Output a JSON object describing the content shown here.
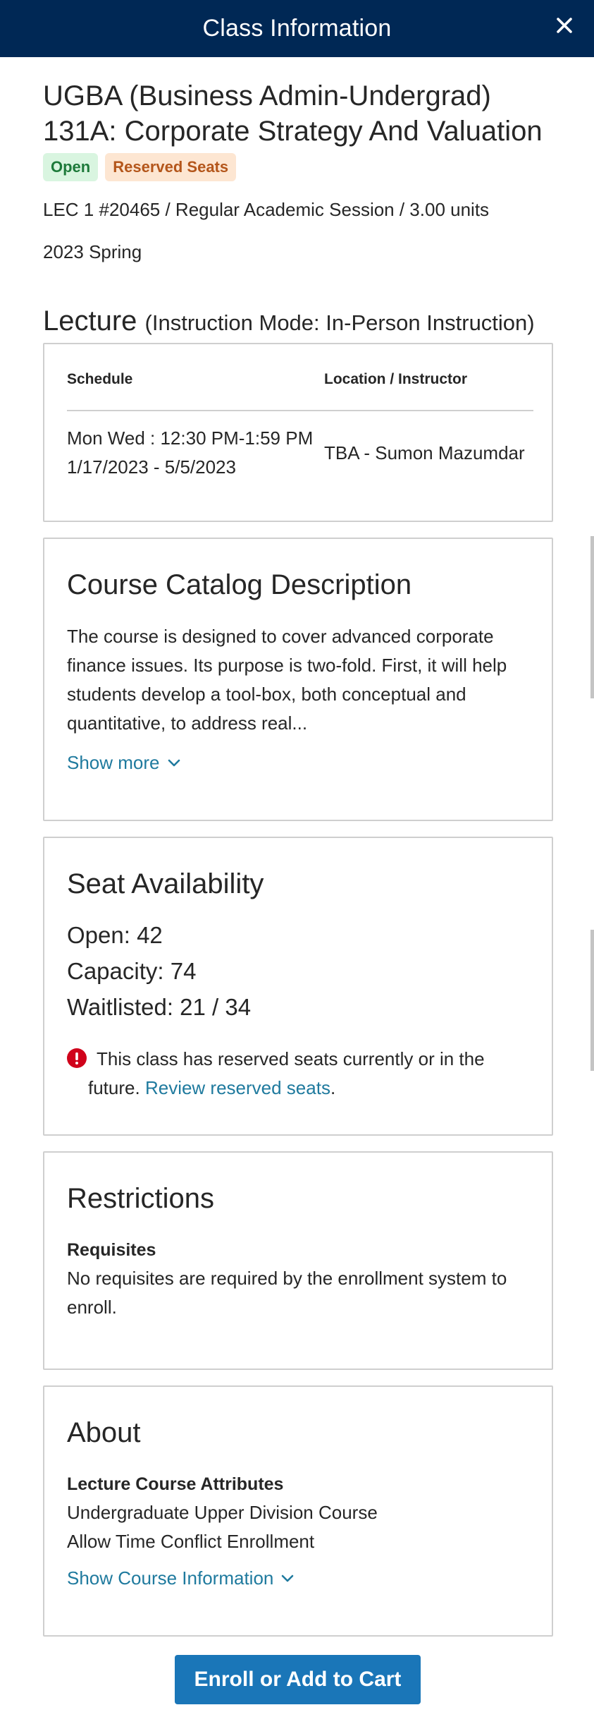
{
  "header": {
    "title": "Class Information",
    "close_icon": "close-icon"
  },
  "course": {
    "title": "UGBA (Business Admin-Undergrad) 131A: Corporate Strategy And Valuation",
    "badges": [
      {
        "label": "Open",
        "color": "#1d7a3a",
        "bg": "#d9f5e0"
      },
      {
        "label": "Reserved Seats",
        "color": "#b4561b",
        "bg": "#fde6d2"
      }
    ],
    "section_line": "LEC 1 #20465 / Regular Academic Session / 3.00 units",
    "term": "2023 Spring"
  },
  "lecture": {
    "heading": "Lecture",
    "mode": "(Instruction Mode: In-Person Instruction)",
    "columns": [
      "Schedule",
      "Location / Instructor"
    ],
    "schedule_days_time": "Mon Wed : 12:30 PM-1:59 PM",
    "schedule_dates": "1/17/2023 - 5/5/2023",
    "location_instructor": "TBA - Sumon Mazumdar"
  },
  "catalog": {
    "title": "Course Catalog Description",
    "description": "The course is designed to cover advanced corporate finance issues. Its purpose is two-fold. First, it will help students develop a tool-box, both conceptual and quantitative, to address real...",
    "show_more": "Show more"
  },
  "seats": {
    "title": "Seat Availability",
    "open": "Open: 42",
    "capacity": "Capacity: 74",
    "waitlisted": "Waitlisted: 21 / 34",
    "alert_text": "This class has reserved seats currently or in the future.",
    "alert_link": "Review reserved seats",
    "alert_end": "."
  },
  "restrictions": {
    "title": "Restrictions",
    "label": "Requisites",
    "text": "No requisites are required by the enrollment system to enroll."
  },
  "about": {
    "title": "About",
    "label": "Lecture Course Attributes",
    "items": [
      "Undergraduate Upper Division Course",
      "Allow Time Conflict Enrollment"
    ],
    "show_info": "Show Course Information"
  },
  "enroll_button": "Enroll or Add to Cart",
  "colors": {
    "header": "#002855",
    "link": "#1f7a9e",
    "button": "#1a76b8",
    "alert": "#d0021b"
  }
}
